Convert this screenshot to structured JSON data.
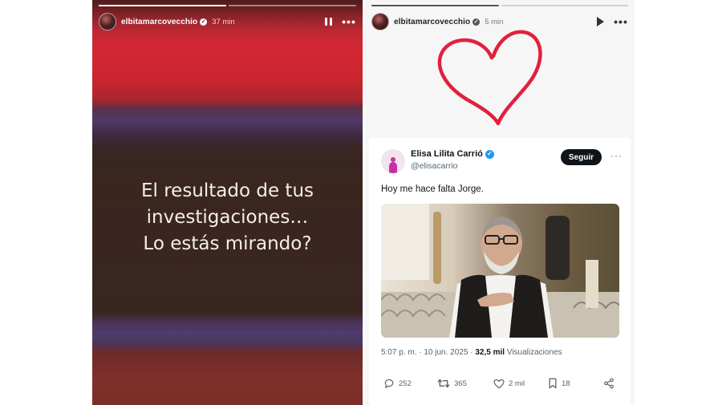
{
  "left_story": {
    "username": "elbitamarcovecchio",
    "time_ago": "37 min",
    "progress": [
      1.0,
      0.0
    ],
    "text_lines": [
      "El resultado de tus",
      "investigaciones…",
      "Lo estás mirando?"
    ],
    "control_icons": [
      "pause-icon",
      "more-icon"
    ]
  },
  "right_story": {
    "username": "elbitamarcovecchio",
    "time_ago": "5 min",
    "progress": [
      1.0,
      0.0
    ],
    "control_icons": [
      "play-icon",
      "more-icon"
    ],
    "sticker": "heart-icon",
    "sticker_color": "#e0213e",
    "tweet": {
      "name": "Elisa Lilita Carrió",
      "handle": "@elisacarrio",
      "follow_label": "Seguir",
      "more": "···",
      "text": "Hoy me hace falta Jorge.",
      "time": "5:07 p. m.",
      "sep": "·",
      "date": "10 jun. 2025",
      "sep2": "·",
      "views_count": "32,5 mil",
      "views_label": "Visualizaciones",
      "replies": "252",
      "retweets": "365",
      "likes": "2 mil",
      "bookmarks": "18"
    }
  },
  "colors": {
    "twitter_blue": "#1d9bf0",
    "follow_button": "#0f1419",
    "avatar_figure": "#c92ea7"
  }
}
